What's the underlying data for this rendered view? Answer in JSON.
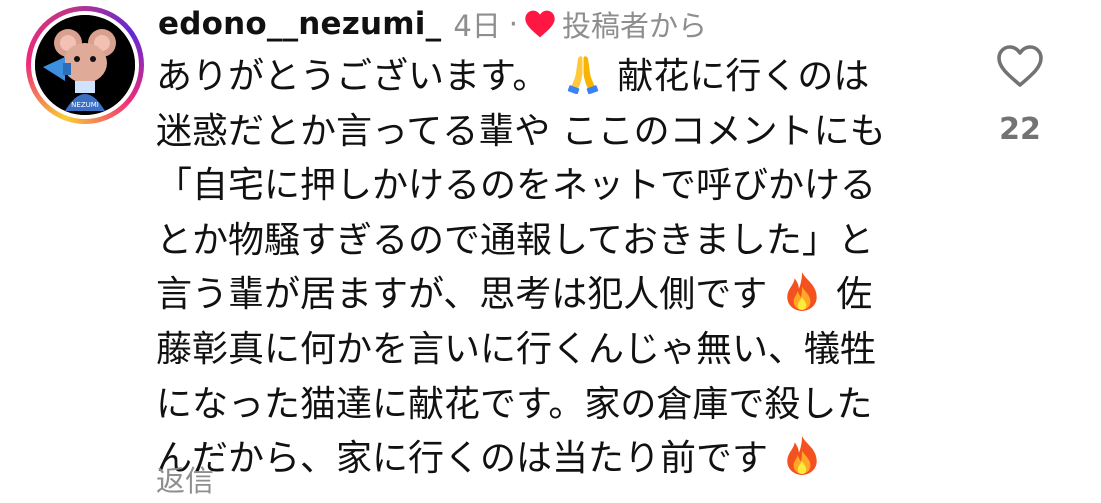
{
  "comment": {
    "username": "edono__nezumi_",
    "time_ago": "4日",
    "separator": "·",
    "author_liked_label": "投稿者から",
    "avatar_text": "NEZUMI",
    "lines": [
      {
        "pre": "ありがとうございます。",
        "emoji": "folded-hands-emoji",
        "post": "献花に行くのは"
      },
      {
        "pre": "迷惑だとか言ってる輩や ここのコメントにも",
        "emoji": null,
        "post": ""
      },
      {
        "pre": "「自宅に押しかけるのをネットで呼びかける",
        "emoji": null,
        "post": ""
      },
      {
        "pre": "とか物騒すぎるので通報しておきました」と",
        "emoji": null,
        "post": ""
      },
      {
        "pre": "言う輩が居ますが、思考は犯人側です",
        "emoji": "fire-emoji",
        "post": "佐"
      },
      {
        "pre": "藤彰真に何かを言いに行くんじゃ無い、犠牲",
        "emoji": null,
        "post": ""
      },
      {
        "pre": "になった猫達に献花です。家の倉庫で殺した",
        "emoji": null,
        "post": ""
      },
      {
        "pre": "んだから、家に行くのは当たり前です",
        "emoji": "fire-emoji",
        "post": ""
      }
    ],
    "like_count": "22",
    "reply_label": "返信"
  },
  "colors": {
    "text": "#111111",
    "muted": "#8e8e8e",
    "heart_red": "#ff1744"
  }
}
